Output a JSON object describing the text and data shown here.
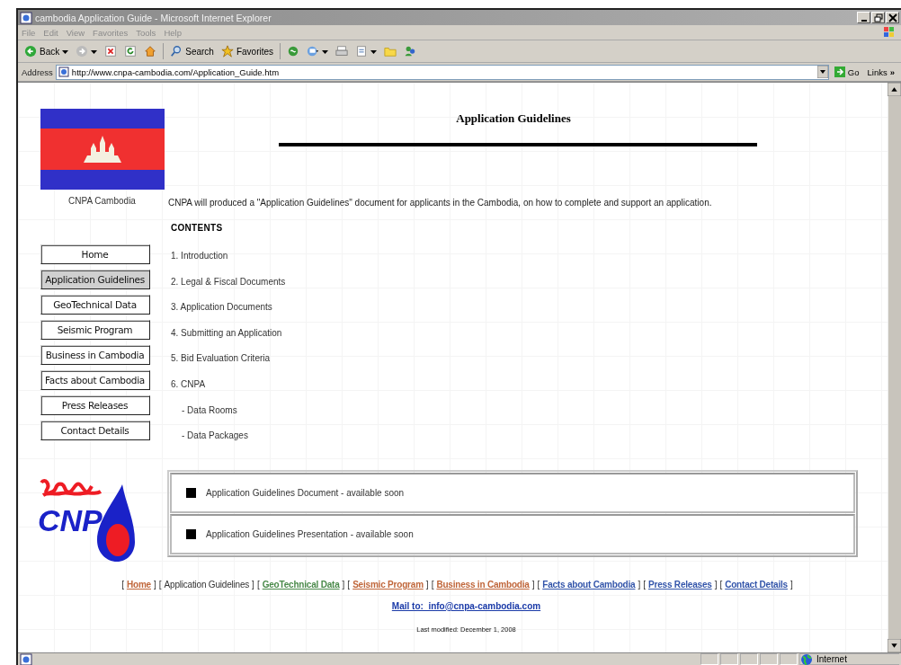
{
  "window": {
    "title": "cambodia Application Guide - Microsoft Internet Explorer"
  },
  "menu": [
    "File",
    "Edit",
    "View",
    "Favorites",
    "Tools",
    "Help"
  ],
  "toolbar": [
    {
      "kind": "back",
      "label": "Back"
    },
    {
      "kind": "forward"
    },
    {
      "kind": "stop"
    },
    {
      "kind": "refresh"
    },
    {
      "kind": "home"
    },
    {
      "kind": "search",
      "label": "Search"
    },
    {
      "kind": "favorites",
      "label": "Favorites"
    },
    {
      "kind": "media"
    },
    {
      "kind": "mail"
    },
    {
      "kind": "print"
    },
    {
      "kind": "edit"
    },
    {
      "kind": "folder"
    },
    {
      "kind": "messenger"
    }
  ],
  "address": {
    "label": "Address",
    "url": "http://www.cnpa-cambodia.com/Application_Guide.htm",
    "go": "Go",
    "links": "Links",
    "more": "»"
  },
  "sidebar": {
    "flag_caption": "CNPA Cambodia",
    "nav": [
      {
        "label": "Home",
        "selected": false
      },
      {
        "label": "Application Guidelines",
        "selected": true
      },
      {
        "label": "GeoTechnical Data",
        "selected": false
      },
      {
        "label": "Seismic Program",
        "selected": false
      },
      {
        "label": "Business in Cambodia",
        "selected": false
      },
      {
        "label": "Facts about Cambodia",
        "selected": false
      },
      {
        "label": "Press Releases",
        "selected": false
      },
      {
        "label": "Contact Details",
        "selected": false
      }
    ]
  },
  "logo": {
    "text": "CNP"
  },
  "page": {
    "title": "Application Guidelines",
    "intro": "CNPA will produced a \"Application Guidelines\" document for applicants in the Cambodia, on how to complete and support an application.",
    "contents_heading": "CONTENTS",
    "contents": [
      {
        "label": "1. Introduction"
      },
      {
        "label": "2. Legal & Fiscal Documents"
      },
      {
        "label": "3. Application Documents"
      },
      {
        "label": "4. Submitting an Application"
      },
      {
        "label": "5. Bid Evaluation Criteria"
      },
      {
        "label": "6. CNPA",
        "children": [
          {
            "label": "- Data Rooms"
          },
          {
            "label": "- Data Packages"
          }
        ]
      }
    ],
    "downloads": [
      "Application Guidelines Document - available soon",
      "Application Guidelines Presentation - available soon"
    ]
  },
  "footer": {
    "links": [
      {
        "before": "[",
        "label": "Home",
        "after": "]",
        "selected": false,
        "color": "#c0663a"
      },
      {
        "before": "[",
        "label": "Application Guidelines",
        "after": "]",
        "selected": true
      },
      {
        "before": "[",
        "label": "GeoTechnical Data",
        "after": "]",
        "selected": false,
        "color": "#4a8a4a"
      },
      {
        "before": "[",
        "label": "Seismic Program",
        "after": "]",
        "selected": false,
        "color": "#c0663a"
      },
      {
        "before": "[",
        "label": "Business in Cambodia",
        "after": "]",
        "selected": false,
        "color": "#c0663a"
      },
      {
        "before": "[",
        "label": "Facts about Cambodia",
        "after": "]",
        "selected": false,
        "color": "#3355aa"
      },
      {
        "before": "[",
        "label": "Press Releases",
        "after": "]",
        "selected": false,
        "color": "#3355aa"
      },
      {
        "before": "[",
        "label": "Contact Details",
        "after": "]",
        "selected": false,
        "color": "#3355aa"
      }
    ],
    "mail": "Mail to:  info@cnpa-cambodia.com",
    "modified": "Last modified: December 1, 2008"
  },
  "status_bar": {
    "zone": "Internet"
  }
}
